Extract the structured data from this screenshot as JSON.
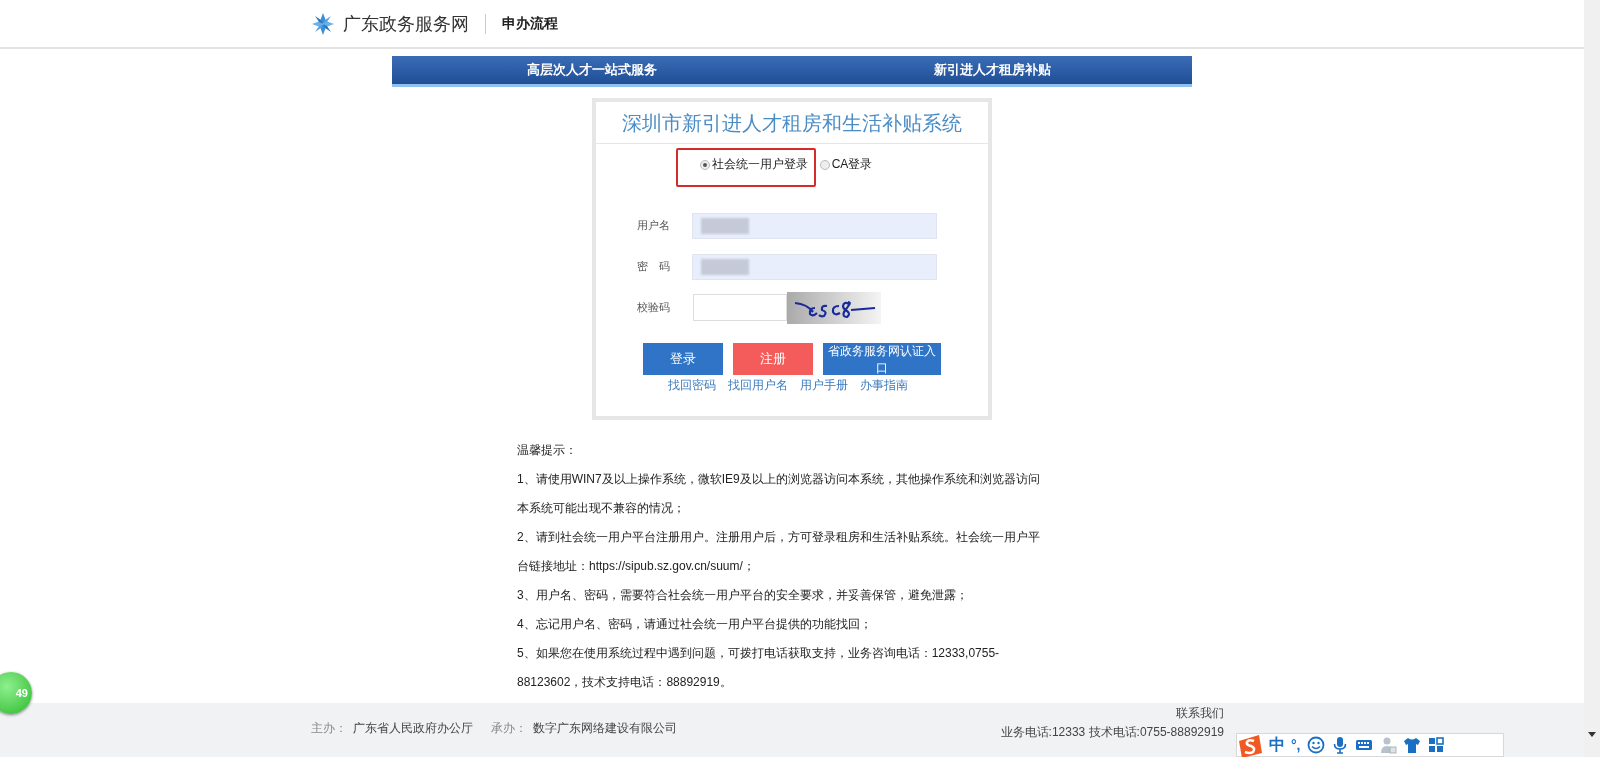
{
  "header": {
    "site_name": "广东政务服务网",
    "section": "申办流程"
  },
  "nav": [
    {
      "label": "高层次人才一站式服务"
    },
    {
      "label": "新引进人才租房补贴"
    }
  ],
  "login": {
    "title": "深圳市新引进人才租房和生活补贴系统",
    "modes": [
      {
        "label": "社会统一用户登录",
        "selected": true,
        "highlighted": true
      },
      {
        "label": "CA登录",
        "selected": false,
        "highlighted": false
      }
    ],
    "fields": [
      {
        "label": "用户名",
        "kind": "redacted"
      },
      {
        "label": "密　码",
        "kind": "redacted"
      },
      {
        "label": "校验码",
        "kind": "captcha"
      }
    ],
    "buttons": [
      {
        "label": "登录",
        "color": "#2f74c6"
      },
      {
        "label": "注册",
        "color": "#f45c5c"
      },
      {
        "label": "省政务服务网认证入口",
        "color": "#2f74c6"
      }
    ],
    "links": [
      "找回密码",
      "找回用户名",
      "用户手册",
      "办事指南"
    ]
  },
  "tips": {
    "heading": "温馨提示：",
    "lines": [
      "1、请使用WIN7及以上操作系统，微软IE9及以上的浏览器访问本系统，其他操作系统和浏览器访问",
      "本系统可能出现不兼容的情况；",
      "2、请到社会统一用户平台注册用户。注册用户后，方可登录租房和生活补贴系统。社会统一用户平",
      "台链接地址：https://sipub.sz.gov.cn/suum/；",
      "3、用户名、密码，需要符合社会统一用户平台的安全要求，并妥善保管，避免泄露；",
      "4、忘记用户名、密码，请通过社会统一用户平台提供的功能找回；",
      "5、如果您在使用系统过程中遇到问题，可拨打电话获取支持，业务咨询电话：12333,0755-",
      "88123602，技术支持电话：88892919。"
    ]
  },
  "footer": {
    "sponsor_label": "主办：",
    "sponsor": "广东省人民政府办公厅",
    "operator_label": "承办：",
    "operator": "数字广东网络建设有限公司",
    "contact_title": "联系我们",
    "contact_phones": "业务电话:12333  技术电话:0755-88892919"
  },
  "floating_badge": "49",
  "ime_toolbar": {
    "mode": "中",
    "punctuation": "°,"
  }
}
